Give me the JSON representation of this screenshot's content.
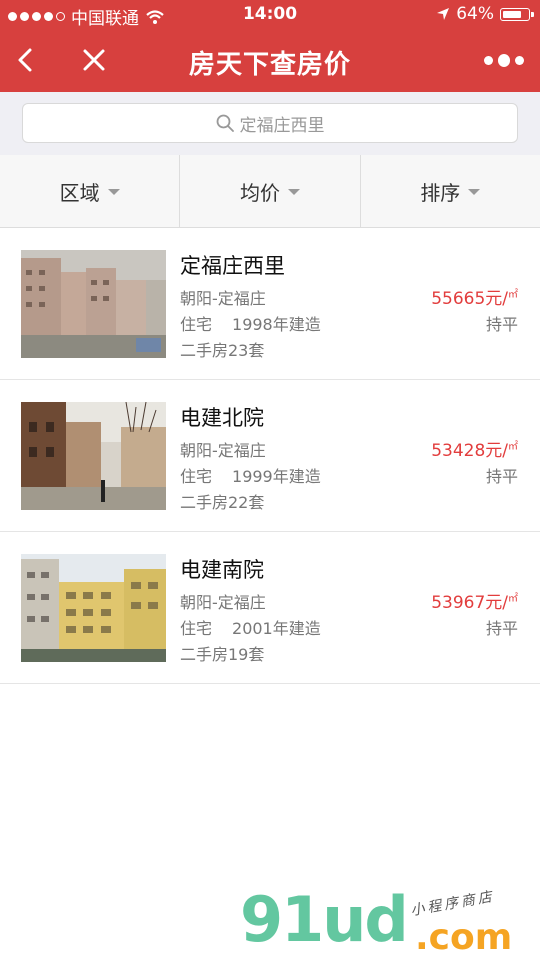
{
  "status_bar": {
    "carrier": "中国联通",
    "time": "14:00",
    "battery": "64%"
  },
  "nav": {
    "title": "房天下查房价"
  },
  "search": {
    "placeholder": "定福庄西里"
  },
  "filters": [
    {
      "label": "区域"
    },
    {
      "label": "均价"
    },
    {
      "label": "排序"
    }
  ],
  "listings": [
    {
      "name": "定福庄西里",
      "district": "朝阳-定福庄",
      "type": "住宅",
      "built": "1998年建造",
      "stock": "二手房23套",
      "price": "55665元/",
      "unit": "㎡",
      "trend": "持平"
    },
    {
      "name": "电建北院",
      "district": "朝阳-定福庄",
      "type": "住宅",
      "built": "1999年建造",
      "stock": "二手房22套",
      "price": "53428元/",
      "unit": "㎡",
      "trend": "持平"
    },
    {
      "name": "电建南院",
      "district": "朝阳-定福庄",
      "type": "住宅",
      "built": "2001年建造",
      "stock": "二手房19套",
      "price": "53967元/",
      "unit": "㎡",
      "trend": "持平"
    }
  ],
  "watermark": {
    "brand": "91ud",
    "tld": ".com",
    "slogan": "小程序商店"
  },
  "colors": {
    "header": "#d7403e",
    "price": "#e23d3d",
    "watermark_green": "#63c7a0",
    "watermark_orange": "#f5a423"
  }
}
